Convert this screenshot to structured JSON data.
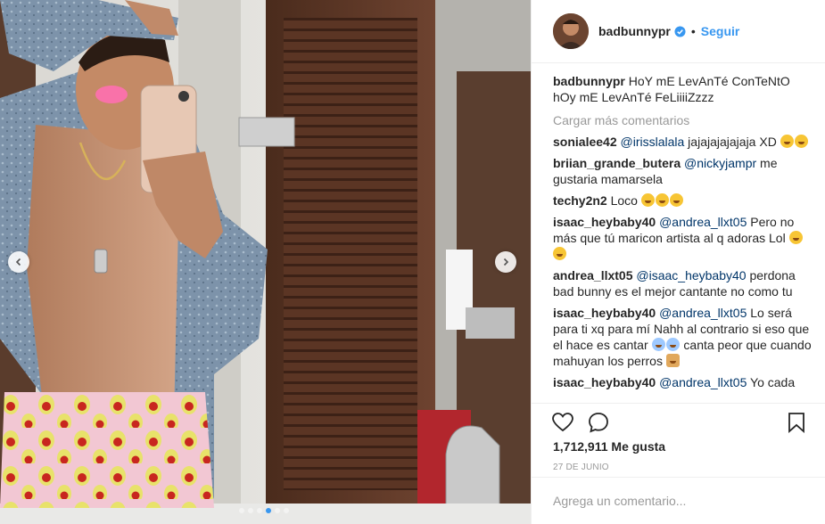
{
  "post": {
    "username": "badbunnypr",
    "verified": true,
    "separator": "•",
    "follow_label": "Seguir",
    "image_alt_icon": "photo",
    "carousel": {
      "dots": 6,
      "active_index": 3
    }
  },
  "caption": {
    "user": "badbunnypr",
    "text": "HoY mE LevAnTé ConTeNtO hOy mE LevAnTé FeLiiiiZzzz"
  },
  "load_more_label": "Cargar más comentarios",
  "comments": [
    {
      "user": "sonialee42",
      "mention": "@irisslalala",
      "text": " jajajajajajaja XD ",
      "emojis": [
        "laugh",
        "laugh"
      ]
    },
    {
      "user": "briian_grande_butera",
      "mention": "@nickyjampr",
      "text": " me gustaria mamarsela",
      "emojis": []
    },
    {
      "user": "techy2n2",
      "mention": "",
      "text": "Loco ",
      "emojis": [
        "laugh",
        "laugh",
        "laugh"
      ]
    },
    {
      "user": "isaac_heybaby40",
      "mention": "@andrea_llxt05",
      "text": " Pero no más que tú maricon artista al q adoras Lol ",
      "emojis": [
        "laugh",
        "laugh"
      ]
    },
    {
      "user": "andrea_llxt05",
      "mention": "@isaac_heybaby40",
      "text": " perdona bad bunny es el mejor cantante no como tu",
      "emojis": []
    },
    {
      "user": "isaac_heybaby40",
      "mention": "@andrea_llxt05",
      "text": " Lo será para ti xq para mí Nahh al contrario si eso que el hace es cantar ",
      "emojis": [
        "shock",
        "shock"
      ],
      "text2": " canta peor que cuando mahuyan los perros ",
      "emojis2": [
        "dog"
      ]
    },
    {
      "user": "isaac_heybaby40",
      "mention": "@andrea_llxt05",
      "text": " Yo cada",
      "emojis": []
    }
  ],
  "actions": {
    "like_icon": "heart-icon",
    "comment_icon": "comment-bubble-icon",
    "save_icon": "bookmark-icon",
    "likes_count": "1,712,911",
    "likes_label": "Me gusta",
    "date": "27 DE JUNIO"
  },
  "add_comment": {
    "placeholder": "Agrega un comentario..."
  },
  "colors": {
    "accent": "#3897f0",
    "mention": "#003569",
    "muted": "#999999",
    "text": "#262626"
  }
}
